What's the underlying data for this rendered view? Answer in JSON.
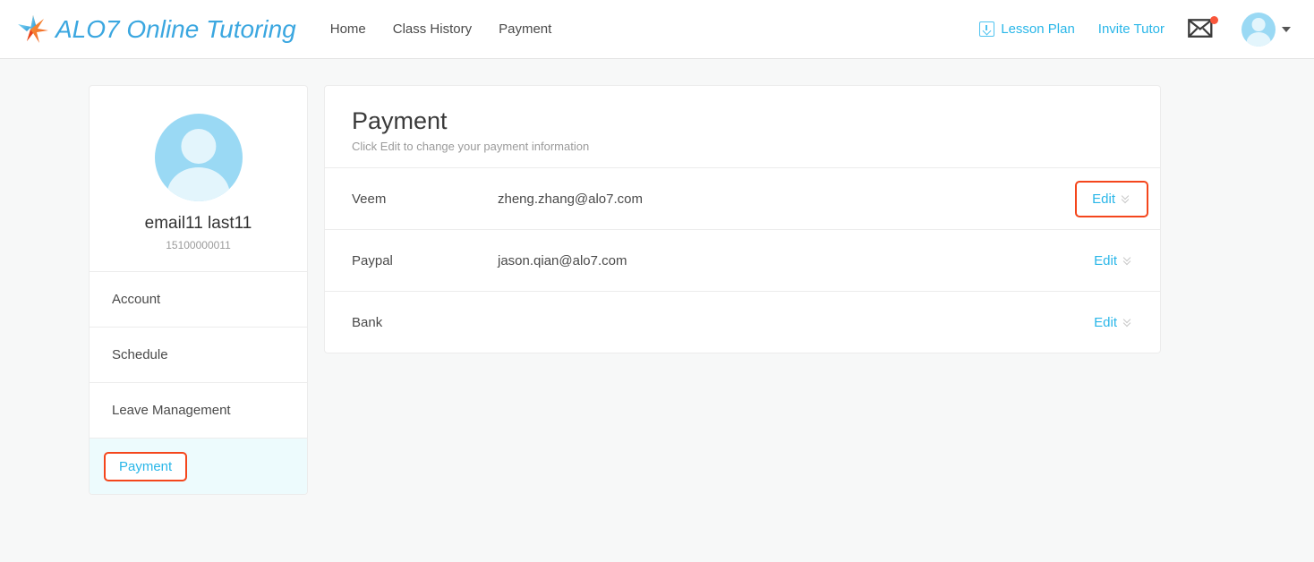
{
  "header": {
    "brand": "ALO7 Online Tutoring",
    "logo_icon": "alo7-star-arrow-logo",
    "nav": [
      {
        "label": "Home"
      },
      {
        "label": "Class History"
      },
      {
        "label": "Payment"
      }
    ],
    "lesson_plan": {
      "label": "Lesson Plan",
      "icon": "download-box-icon"
    },
    "invite_tutor": {
      "label": "Invite Tutor"
    },
    "mail": {
      "icon": "envelope-icon",
      "badge_icon": "notification-dot",
      "badge_color": "#f9563b"
    },
    "avatar": {
      "icon": "user-avatar-icon",
      "caret_icon": "caret-down-icon"
    }
  },
  "sidebar": {
    "profile": {
      "avatar_icon": "user-avatar-icon",
      "name": "email11 last11",
      "phone": "15100000011"
    },
    "items": [
      {
        "label": "Account",
        "active": false
      },
      {
        "label": "Schedule",
        "active": false
      },
      {
        "label": "Leave Management",
        "active": false
      },
      {
        "label": "Payment",
        "active": true
      }
    ]
  },
  "main": {
    "title": "Payment",
    "subtitle": "Click Edit to change your payment information",
    "edit_label": "Edit",
    "rows": [
      {
        "name": "Veem",
        "value": "zheng.zhang@alo7.com",
        "highlighted": true
      },
      {
        "name": "Paypal",
        "value": "jason.qian@alo7.com",
        "highlighted": false
      },
      {
        "name": "Bank",
        "value": "",
        "highlighted": false
      }
    ]
  },
  "colors": {
    "accent": "#29b6e8",
    "brand": "#3ba7e0",
    "annotation": "#f4461c",
    "active_row_bg": "#edfbfd",
    "page_bg": "#f7f8f8"
  }
}
